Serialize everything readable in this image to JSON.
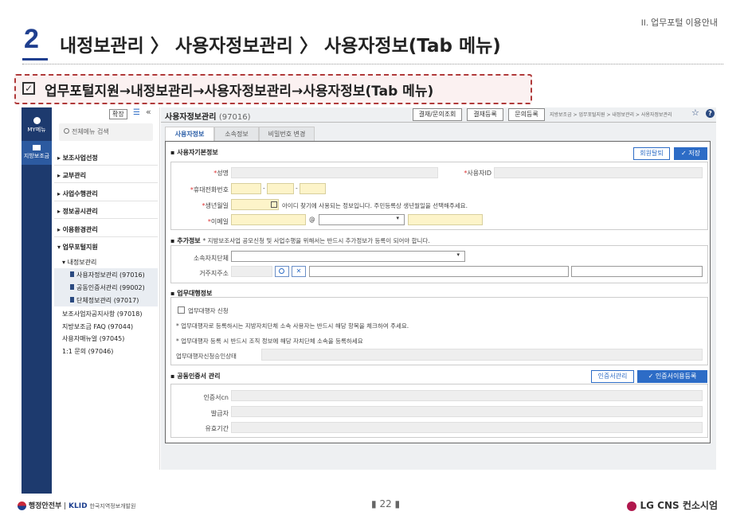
{
  "slide": {
    "section_tag": "II. 업무포털 이용안내",
    "number": "2",
    "title": "내정보관리 〉 사용자정보관리 〉 사용자정보(Tab 메뉴)",
    "path": "업무포털지원→내정보관리→사용자정보관리→사용자정보(Tab 메뉴)",
    "check_glyph": "✓",
    "page": "22",
    "page_mark_left": "▮",
    "page_mark_right": "▮",
    "footer_org": "행정안전부",
    "footer_klid": "KLID",
    "footer_klid_sub": "한국지역정보개발원",
    "footer_company": "LG CNS 컨소시엄"
  },
  "rail": {
    "my_menu": "MY메뉴",
    "subsidy": "지방보조금"
  },
  "sidebar": {
    "expand": "확장",
    "list_icon": "☰",
    "collapse": "«",
    "search_placeholder": "전체메뉴 검색",
    "menus": [
      "보조사업선정",
      "교부관리",
      "사업수행관리",
      "정보공시관리",
      "이용환경관리",
      "업무포털지원"
    ],
    "sub_group": "내정보관리",
    "sub_items": [
      "사용자정보관리 (97016)",
      "공동인증서관리 (99002)",
      "단체정보관리 (97017)"
    ],
    "bottom_items": [
      "보조사업자공지사항 (97018)",
      "지방보조금 FAQ (97044)",
      "사용자매뉴얼 (97045)",
      "1:1 문의 (97046)"
    ]
  },
  "main": {
    "page_title": "사용자정보관리",
    "page_code": "(97016)",
    "top_buttons": [
      "결재/문의조회",
      "결재등록",
      "문의등록"
    ],
    "breadcrumb": "지방보조금 > 업무포털지원 > 내정보관리 > 사용자정보관리",
    "star": "☆",
    "help": "?",
    "tabs": [
      "사용자정보",
      "소속정보",
      "비밀번호 변경"
    ],
    "basic": {
      "title": "사용자기본정보",
      "withdraw": "회원탈퇴",
      "save": "저장",
      "name_label": "성명",
      "userid_label": "사용자ID",
      "phone_label": "휴대전화번호",
      "phone_dash": "-",
      "birth_label": "생년월일",
      "birth_note": "아이디 찾기에 사용되는 정보입니다. 주민등록상 생년월일을 선택해주세요.",
      "email_label": "이메일",
      "email_at": "@",
      "req": "*"
    },
    "extra": {
      "title": "추가정보",
      "note": "* 지방보조사업 공모신청 및 사업수행을 위해서는 반드시 추가정보가 등록이 되어야 합니다.",
      "local_gov_label": "소속자치단체",
      "address_label": "거주지주소"
    },
    "proxy": {
      "title": "업무대행정보",
      "checkbox_label": "업무대행자 신청",
      "note1": "* 업무대행자로 등록하시는 지방자치단체 소속 사용자는 반드시 해당 항목을 체크하여 주세요.",
      "note2": "* 업무대행자 등록 시 반드시 조직 정보에 해당 자치단체 소속을 등록하세요",
      "approval_label": "업무대행자신청승인상태"
    },
    "cert": {
      "title": "공동인증서 관리",
      "manage": "인증서관리",
      "register": "인증서이용등록",
      "cn_label": "인증서cn",
      "issuer_label": "발급자",
      "expiry_label": "유효기간"
    }
  }
}
